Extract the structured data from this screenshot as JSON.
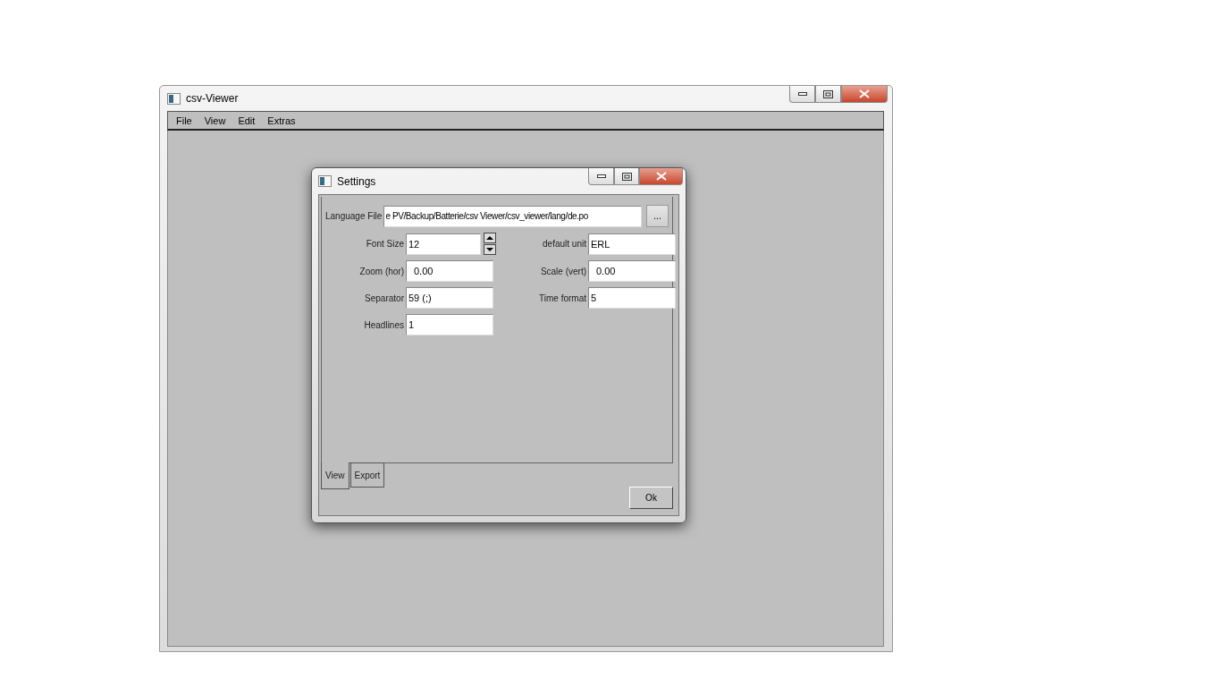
{
  "main_window": {
    "title": "csv-Viewer",
    "menu": [
      {
        "label": "File"
      },
      {
        "label": "View"
      },
      {
        "label": "Edit"
      },
      {
        "label": "Extras"
      }
    ]
  },
  "dialog": {
    "title": "Settings",
    "language_file": {
      "label": "Language File",
      "value": "e PV/Backup/Batterie/csv Viewer/csv_viewer/lang/de.po",
      "browse": "..."
    },
    "fields": [
      {
        "label": "Font Size",
        "value": "12",
        "kind": "spin"
      },
      {
        "label": "default unit",
        "value": "ERL",
        "kind": "text"
      },
      {
        "label": "Zoom (hor)",
        "value": "0.00",
        "kind": "number"
      },
      {
        "label": "Scale (vert)",
        "value": "0.00",
        "kind": "number"
      },
      {
        "label": "Separator",
        "value": "59 (;)",
        "kind": "text"
      },
      {
        "label": "Time format",
        "value": "5",
        "kind": "text"
      },
      {
        "label": "Headlines",
        "value": "1",
        "kind": "text"
      }
    ],
    "tabs": [
      {
        "label": "View",
        "selected": true
      },
      {
        "label": "Export",
        "selected": false
      }
    ],
    "ok": "Ok"
  }
}
